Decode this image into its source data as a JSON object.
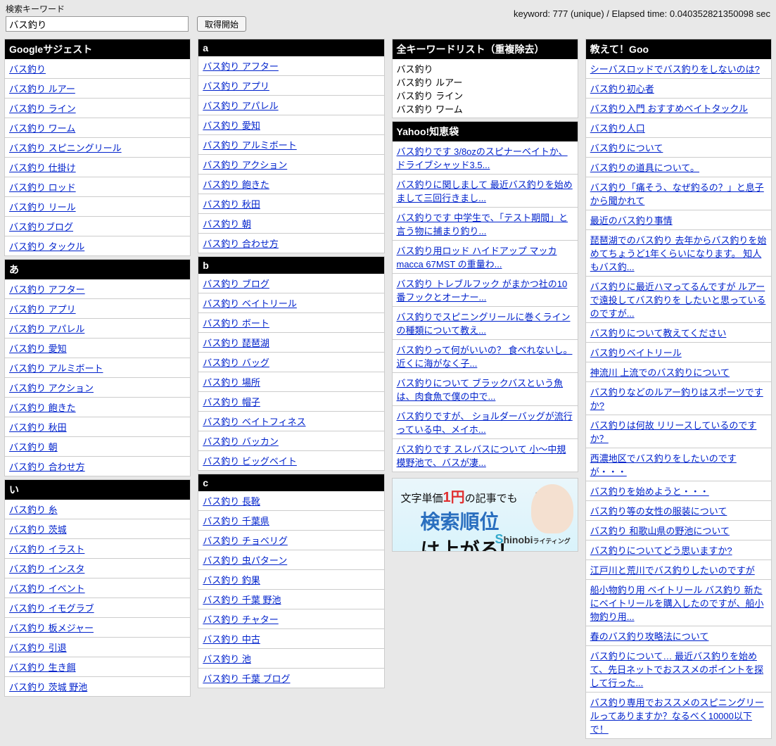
{
  "topbar": {
    "label": "検索キーワード",
    "input_value": "バス釣り",
    "button": "取得開始",
    "status": "keyword: 777 (unique) / Elapsed time: 0.040352821350098 sec"
  },
  "col1": {
    "title": "Googleサジェスト",
    "groups": [
      {
        "head": null,
        "items": [
          "バス釣り",
          "バス釣り ルアー",
          "バス釣り ライン",
          "バス釣り ワーム",
          "バス釣り スピニングリール",
          "バス釣り 仕掛け",
          "バス釣り ロッド",
          "バス釣り リール",
          "バス釣りブログ",
          "バス釣り タックル"
        ]
      },
      {
        "head": "あ",
        "items": [
          "バス釣り アフター",
          "バス釣り アプリ",
          "バス釣り アパレル",
          "バス釣り 愛知",
          "バス釣り アルミボート",
          "バス釣り アクション",
          "バス釣り 飽きた",
          "バス釣り 秋田",
          "バス釣り 朝",
          "バス釣り 合わせ方"
        ]
      },
      {
        "head": "い",
        "items": [
          "バス釣り 糸",
          "バス釣り 茨城",
          "バス釣り イラスト",
          "バス釣り インスタ",
          "バス釣り イベント",
          "バス釣り イモグラブ",
          "バス釣り 板メジャー",
          "バス釣り 引退",
          "バス釣り 生き餌",
          "バス釣り 茨城 野池"
        ]
      }
    ]
  },
  "col2": {
    "groups": [
      {
        "head": "a",
        "items": [
          "バス釣り アフター",
          "バス釣り アプリ",
          "バス釣り アパレル",
          "バス釣り 愛知",
          "バス釣り アルミボート",
          "バス釣り アクション",
          "バス釣り 飽きた",
          "バス釣り 秋田",
          "バス釣り 朝",
          "バス釣り 合わせ方"
        ]
      },
      {
        "head": "b",
        "items": [
          "バス釣り ブログ",
          "バス釣り ベイトリール",
          "バス釣り ボート",
          "バス釣り 琵琶湖",
          "バス釣り バッグ",
          "バス釣り 場所",
          "バス釣り 帽子",
          "バス釣り ベイトフィネス",
          "バス釣り バッカン",
          "バス釣り ビッグベイト"
        ]
      },
      {
        "head": "c",
        "items": [
          "バス釣り 長靴",
          "バス釣り 千葉県",
          "バス釣り チョベリグ",
          "バス釣り 虫パターン",
          "バス釣り 釣果",
          "バス釣り 千葉 野池",
          "バス釣り チャター",
          "バス釣り 中古",
          "バス釣り 池",
          "バス釣り 千葉 ブログ"
        ]
      }
    ]
  },
  "col3": {
    "list_title": "全キーワードリスト（重複除去）",
    "list_text": "バス釣り\nバス釣り ルアー\nバス釣り ライン\nバス釣り ワーム",
    "yahoo_title": "Yahoo!知恵袋",
    "yahoo_items": [
      "バス釣りです 3/8ozのスピナーベイトか、ドライブシャッド3.5...",
      "バス釣りに関しまして 最近バス釣りを始めまして三回行きまし...",
      "バス釣りです 中学生で、「テスト期間」と言う物に捕まり釣り...",
      "バス釣り用ロッド ハイドアップ マッカ macca 67MST の重量わ...",
      "バス釣り トレブルフック がまかつ社の10番フックとオーナー...",
      "バス釣りでスピニングリールに巻くラインの種類について教え...",
      "バス釣りって何がいいの？ 食べれないし。 近くに海がなく子...",
      "バス釣りについて ブラックバスという魚は、肉食魚で僕の中で...",
      "バス釣りですが、 ショルダーバッグが流行っている中、メイホ...",
      "バス釣りです スレバスについて 小～中規模野池で、バスが凄..."
    ],
    "banner": {
      "line1a": "文字単価",
      "line1b": "1円",
      "line1c": "の記事でも",
      "note": "♪",
      "line2a": "検索順位",
      "line2b": "は上がる!",
      "logo": "Shinobi"
    }
  },
  "col4": {
    "title": "教えて！Goo",
    "items": [
      "シーバスロッドでバス釣りをしないのは?",
      "バス釣り初心者",
      "バス釣り入門 おすすめベイトタックル",
      "バス釣り人口",
      "バス釣りについて",
      "バス釣りの道具について。",
      "バス釣り「痛そう、なぜ釣るの？」と息子から聞かれて",
      "最近のバス釣り事情",
      "琵琶湖でのバス釣り 去年からバス釣りを始めてちょうど1年くらいになります。 知人もバス釣...",
      "バス釣りに最近ハマってるんですが ルアーで遠投してバス釣りを したいと思っているのですが...",
      "バス釣りについて教えてください",
      "バス釣りベイトリール",
      "神流川 上流でのバス釣りについて",
      "バス釣りなどのルアー釣りはスポーツですか?",
      "バス釣りは何故 リリースしているのですか？",
      "西濃地区でバス釣りをしたいのですが・・・",
      "バス釣りを始めようと・・・",
      "バス釣り等の女性の服装について",
      "バス釣り 和歌山県の野池について",
      "バス釣りについてどう思いますか?",
      "江戸川と荒川でバス釣りしたいのですが",
      "船小物釣り用 ベイトリール バス釣り 新たにベイトリールを購入したのですが、船小物釣り用...",
      "春のバス釣り攻略法について",
      "バス釣りについて… 最近バス釣りを始めて、先日ネットでおススメのポイントを探して行った...",
      "バス釣り専用でおススメのスピニングリールってありますか？なるべく10000以下で！"
    ]
  }
}
